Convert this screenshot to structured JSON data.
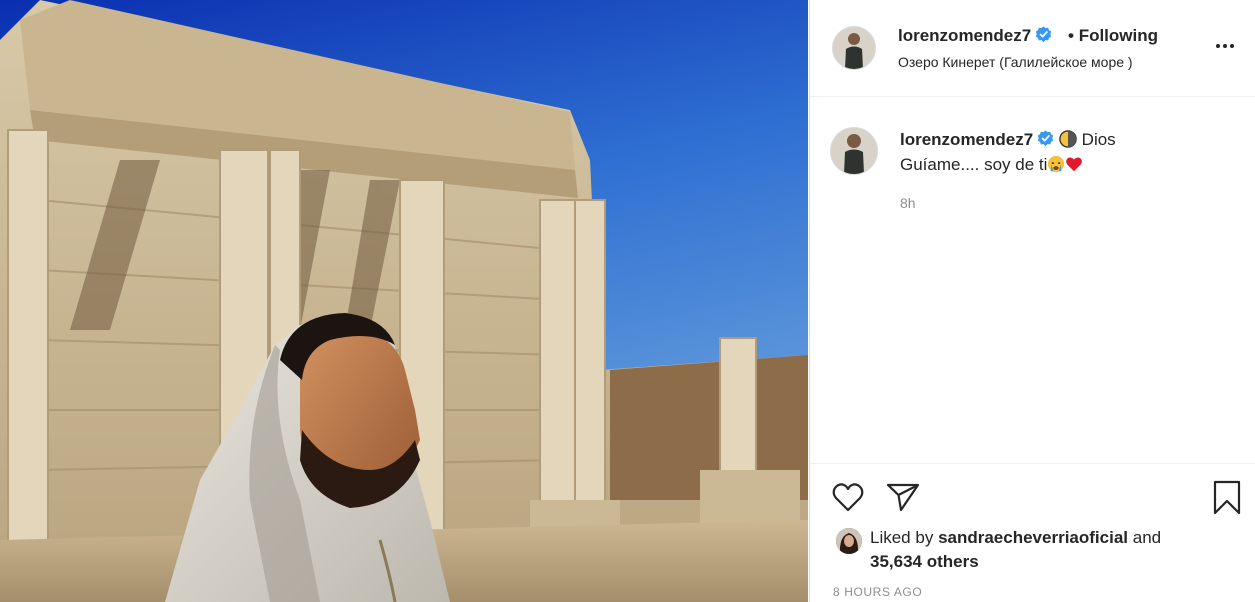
{
  "post": {
    "image_alt": "Man in a white hood standing in front of ancient stone ruins with columns under a blue sky",
    "username": "lorenzomendez7",
    "verified": true,
    "following_label": "Following",
    "separator": "•",
    "location": "Озеро Кинерет (Галилейское море )",
    "more_label": "More options",
    "caption": {
      "username": "lorenzomendez7",
      "text_part1": "Dios",
      "text_part2": "Guíame.... soy de ti",
      "emojis": [
        "new-moon-face-icon",
        "crying-face-icon",
        "red-heart-icon"
      ]
    },
    "comment_time": "8h",
    "likes": {
      "prefix": "Liked by",
      "user": "sandraecheverriaoficial",
      "joiner": "and",
      "others": "35,634 others"
    },
    "time_ago": "8 HOURS AGO"
  },
  "colors": {
    "text": "#262626",
    "muted": "#8e8e8e",
    "verified_blue": "#3897f0",
    "heart_red": "#ed4956",
    "border": "#dbdbdb"
  }
}
